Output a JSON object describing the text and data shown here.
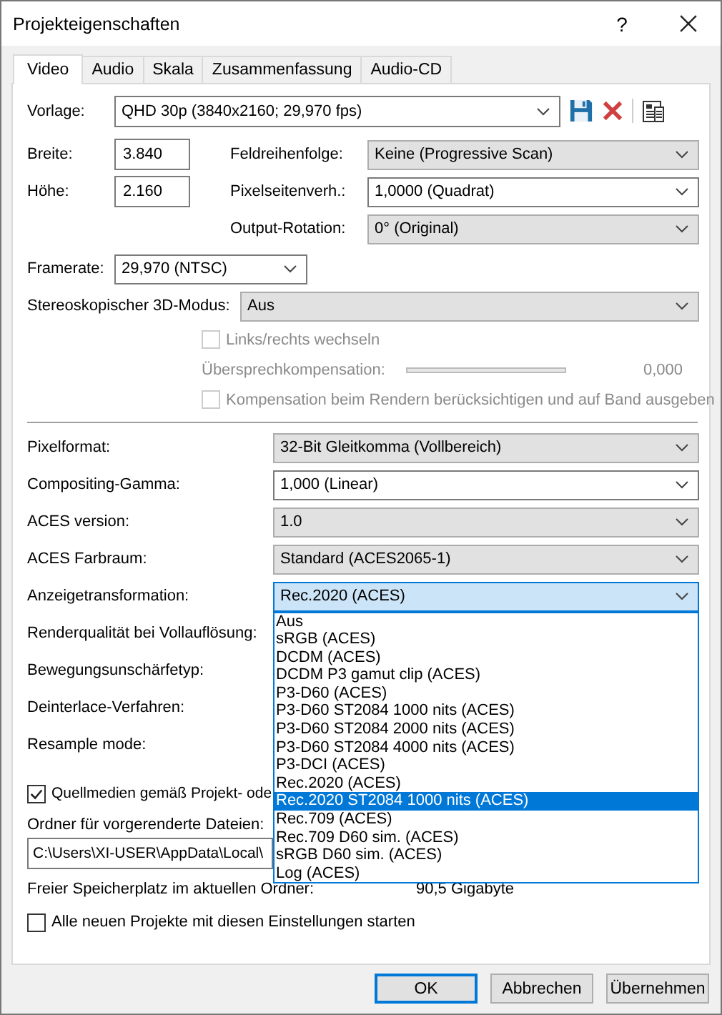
{
  "window": {
    "title": "Projekteigenschaften",
    "help_button": "?"
  },
  "tabs": [
    {
      "label": "Video",
      "selected": true
    },
    {
      "label": "Audio",
      "selected": false
    },
    {
      "label": "Skala",
      "selected": false
    },
    {
      "label": "Zusammenfassung",
      "selected": false
    },
    {
      "label": "Audio-CD",
      "selected": false
    }
  ],
  "template": {
    "label": "Vorlage:",
    "value": "QHD 30p (3840x2160; 29,970 fps)"
  },
  "size_fields": [
    {
      "label": "Breite:",
      "value": "3.840"
    },
    {
      "label": "Höhe:",
      "value": "2.160"
    }
  ],
  "right_combos": [
    {
      "label": "Feldreihenfolge:",
      "value": "Keine (Progressive Scan)",
      "editable": false
    },
    {
      "label": "Pixelseitenverh.:",
      "value": "1,0000 (Quadrat)",
      "editable": true
    },
    {
      "label": "Output-Rotation:",
      "value": "0° (Original)",
      "editable": false
    }
  ],
  "framerate": {
    "label": "Framerate:",
    "value": "29,970 (NTSC)",
    "editable": true
  },
  "stereo": {
    "label": "Stereoskopischer 3D-Modus:",
    "value": "Aus",
    "editable": false
  },
  "stereo_options": {
    "swap": {
      "label": "Links/rechts wechseln",
      "checked": false,
      "disabled": true
    },
    "crosstalk": {
      "label": "Übersprechkompensation:",
      "reading": "0,000",
      "disabled": true
    },
    "render": {
      "label": "Kompensation beim Rendern berücksichtigen und auf Band ausgeben",
      "checked": false,
      "disabled": true
    }
  },
  "settings": [
    {
      "label": "Pixelformat:",
      "value": "32-Bit Gleitkomma (Vollbereich)",
      "editable": false,
      "expanded": false
    },
    {
      "label": "Compositing-Gamma:",
      "value": "1,000 (Linear)",
      "editable": true,
      "expanded": false
    },
    {
      "label": "ACES version:",
      "value": "1.0",
      "editable": false,
      "expanded": false
    },
    {
      "label": "ACES Farbraum:",
      "value": "Standard (ACES2065-1)",
      "editable": false,
      "expanded": false
    },
    {
      "label": "Anzeigetransformation:",
      "value": "Rec.2020 (ACES)",
      "editable": false,
      "expanded": true
    },
    {
      "label": "Renderqualität bei Vollauflösung:"
    },
    {
      "label": "Bewegungsunschärfetyp:"
    },
    {
      "label": "Deinterlace-Verfahren:"
    },
    {
      "label": "Resample mode:"
    }
  ],
  "display_options": [
    {
      "label": "Aus",
      "selected": false
    },
    {
      "label": "sRGB (ACES)",
      "selected": false
    },
    {
      "label": "DCDM (ACES)",
      "selected": false
    },
    {
      "label": "DCDM P3 gamut clip (ACES)",
      "selected": false
    },
    {
      "label": "P3-D60 (ACES)",
      "selected": false
    },
    {
      "label": "P3-D60 ST2084 1000 nits (ACES)",
      "selected": false
    },
    {
      "label": "P3-D60 ST2084 2000 nits (ACES)",
      "selected": false
    },
    {
      "label": "P3-D60 ST2084 4000 nits (ACES)",
      "selected": false
    },
    {
      "label": "P3-DCI (ACES)",
      "selected": false
    },
    {
      "label": "Rec.2020 (ACES)",
      "selected": false
    },
    {
      "label": "Rec.2020 ST2084 1000 nits (ACES)",
      "selected": true
    },
    {
      "label": "Rec.709 (ACES)",
      "selected": false
    },
    {
      "label": "Rec.709 D60 sim. (ACES)",
      "selected": false
    },
    {
      "label": "sRGB D60 sim. (ACES)",
      "selected": false
    },
    {
      "label": "Log (ACES)",
      "selected": false
    }
  ],
  "prerender": {
    "source_checkbox": {
      "label": "Quellmedien gemäß Projekt- ode",
      "checked": true
    },
    "folder_label": "Ordner für vorgerenderte Dateien:",
    "folder_path": "C:\\Users\\XI-USER\\AppData\\Local\\",
    "free_space_label": "Freier Speicherplatz im aktuellen Ordner:",
    "free_space": "90,5 Gigabyte"
  },
  "start_all": {
    "label": "Alle neuen Projekte mit diesen Einstellungen starten",
    "checked": false
  },
  "buttons": [
    {
      "label": "OK",
      "default": true
    },
    {
      "label": "Abbrechen",
      "default": false
    },
    {
      "label": "Übernehmen",
      "default": false
    }
  ]
}
